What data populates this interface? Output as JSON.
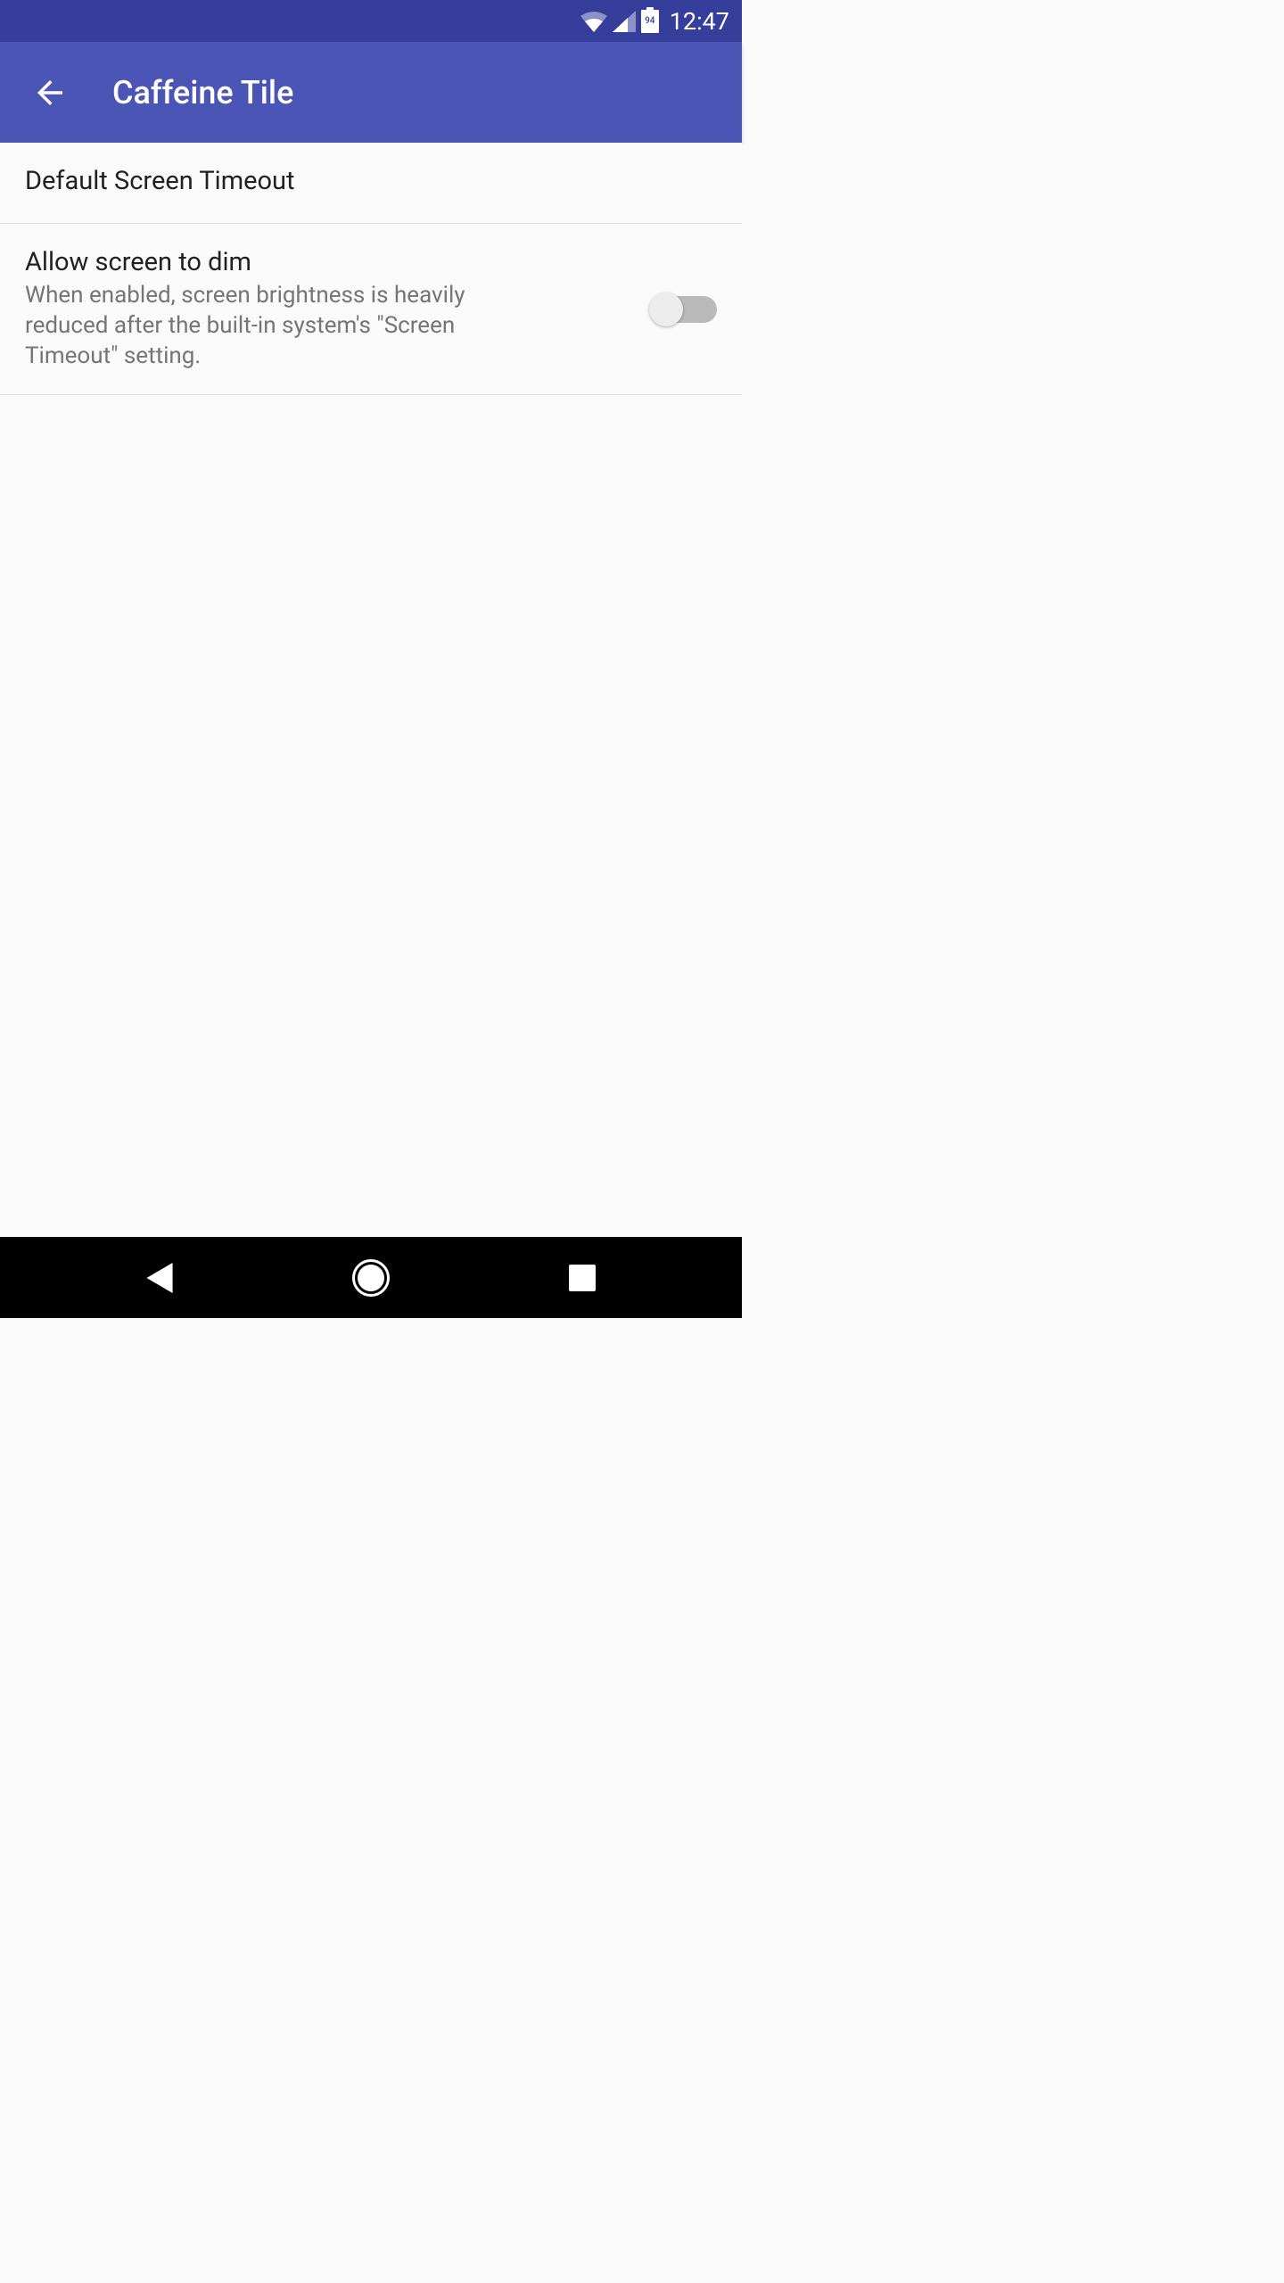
{
  "statusBar": {
    "batteryLevel": "94",
    "time": "12:47"
  },
  "appBar": {
    "title": "Caffeine Tile"
  },
  "settings": {
    "items": [
      {
        "title": "Default Screen Timeout"
      },
      {
        "title": "Allow screen to dim",
        "description": "When enabled, screen brightness is heavily reduced after the built-in system's \"Screen Timeout\" setting.",
        "toggleState": "off"
      }
    ]
  }
}
